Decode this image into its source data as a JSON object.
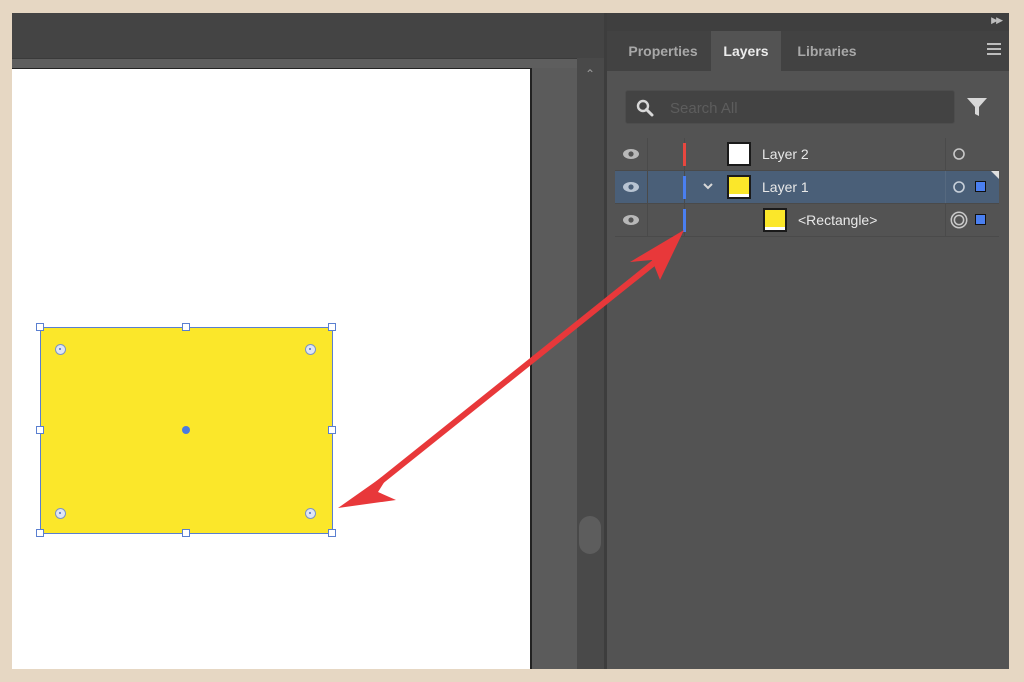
{
  "panel": {
    "tabs": [
      {
        "label": "Properties",
        "active": false
      },
      {
        "label": "Layers",
        "active": true
      },
      {
        "label": "Libraries",
        "active": false
      }
    ],
    "search": {
      "placeholder": "Search All",
      "value": ""
    },
    "layers": [
      {
        "name": "Layer 2",
        "color": "#e8473f",
        "thumbnail_color": "#ffffff",
        "expanded": false,
        "selected": false,
        "target": "ring",
        "has_selection": false,
        "indent": 0
      },
      {
        "name": "Layer 1",
        "color": "#4a7ff0",
        "thumbnail_color": "#fbe72a",
        "expanded": true,
        "selected": true,
        "target": "ring",
        "has_selection": true,
        "indent": 0
      },
      {
        "name": "<Rectangle>",
        "color": "#4a7ff0",
        "thumbnail_color": "#fbe72a",
        "expanded": false,
        "selected": false,
        "target": "double-ring",
        "has_selection": true,
        "indent": 1
      }
    ]
  },
  "canvas": {
    "shape": {
      "type": "rectangle",
      "fill": "#fbe72a",
      "selected": true
    }
  },
  "annotation": {
    "type": "double-headed-arrow",
    "color": "#e8383a",
    "from": "rectangle",
    "to": "layer-color-bar"
  },
  "colors": {
    "accent_blue": "#4a7ff0",
    "layer2_red": "#e8473f",
    "selected_row": "#4a5f78"
  }
}
